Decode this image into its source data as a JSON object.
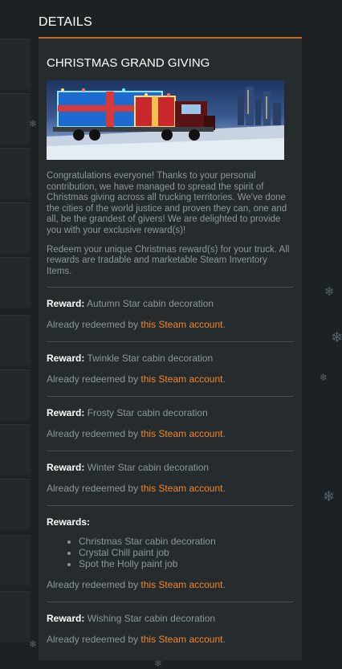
{
  "header": {
    "title": "DETAILS"
  },
  "event": {
    "title": "CHRISTMAS GRAND GIVING",
    "banner_icon": "christmas-truck-banner",
    "paragraphs": [
      "Congratulations everyone! Thanks to your personal contribution, we have managed to spread the spirit of Christmas giving across all trucking territories. We've done the cities of the world justice and proven they can, one and all, be the grandest of givers! We are delighted to provide you with your exclusive reward(s)!",
      "Redeem your unique Christmas reward(s) for your truck. All rewards are tradable and marketable Steam Inventory Items."
    ]
  },
  "rewards": [
    {
      "label": "Reward:",
      "item": "Autumn Star cabin decoration",
      "redeemed_prefix": "Already redeemed by",
      "link": "this Steam account",
      "suffix": "."
    },
    {
      "label": "Reward:",
      "item": "Twinkle Star cabin decoration",
      "redeemed_prefix": "Already redeemed by",
      "link": "this Steam account",
      "suffix": "."
    },
    {
      "label": "Reward:",
      "item": "Frosty Star cabin decoration",
      "redeemed_prefix": "Already redeemed by",
      "link": "this Steam account",
      "suffix": "."
    },
    {
      "label": "Reward:",
      "item": "Winter Star cabin decoration",
      "redeemed_prefix": "Already redeemed by",
      "link": "this Steam account",
      "suffix": "."
    }
  ],
  "multi_reward": {
    "label": "Rewards:",
    "items": [
      "Christmas Star cabin decoration",
      "Crystal Chill paint job",
      "Spot the Holly paint job"
    ],
    "redeemed_prefix": "Already redeemed by",
    "link": "this Steam account",
    "suffix": "."
  },
  "last_reward": {
    "label": "Reward:",
    "item": "Wishing Star cabin decoration",
    "redeemed_prefix": "Already redeemed by",
    "link": "this Steam account",
    "suffix": "."
  },
  "colors": {
    "accent": "#c26b1f",
    "link": "#f1862d",
    "panel": "#262c2e",
    "background": "#1c2123",
    "text": "#8c979c"
  },
  "decor": {
    "snowflake_icon": "snowflake-icon"
  }
}
